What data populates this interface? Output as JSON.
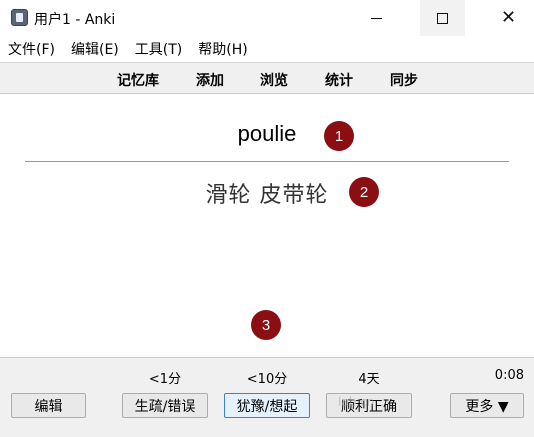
{
  "window": {
    "title": "用户1 - Anki",
    "close_glyph": "✕"
  },
  "menu": [
    {
      "label": "文件(F)"
    },
    {
      "label": "编辑(E)"
    },
    {
      "label": "工具(T)"
    },
    {
      "label": "帮助(H)"
    }
  ],
  "toolbar": {
    "decks": "记忆库",
    "add": "添加",
    "browse": "浏览",
    "stats": "统计",
    "sync": "同步"
  },
  "card": {
    "front": "poulie",
    "back": "滑轮 皮带轮",
    "markers": [
      "1",
      "2",
      "3"
    ],
    "marker_color": "#8b0f12"
  },
  "bottom": {
    "intervals": {
      "again": "<1分",
      "hard": "<10分",
      "good": "4天"
    },
    "timer": "0:08",
    "buttons": {
      "edit": "编辑",
      "again": "生疏/错误",
      "hard": "犹豫/想起",
      "good": "顺利正确",
      "more": "更多 ▼"
    },
    "watermark": "lab.cn"
  }
}
